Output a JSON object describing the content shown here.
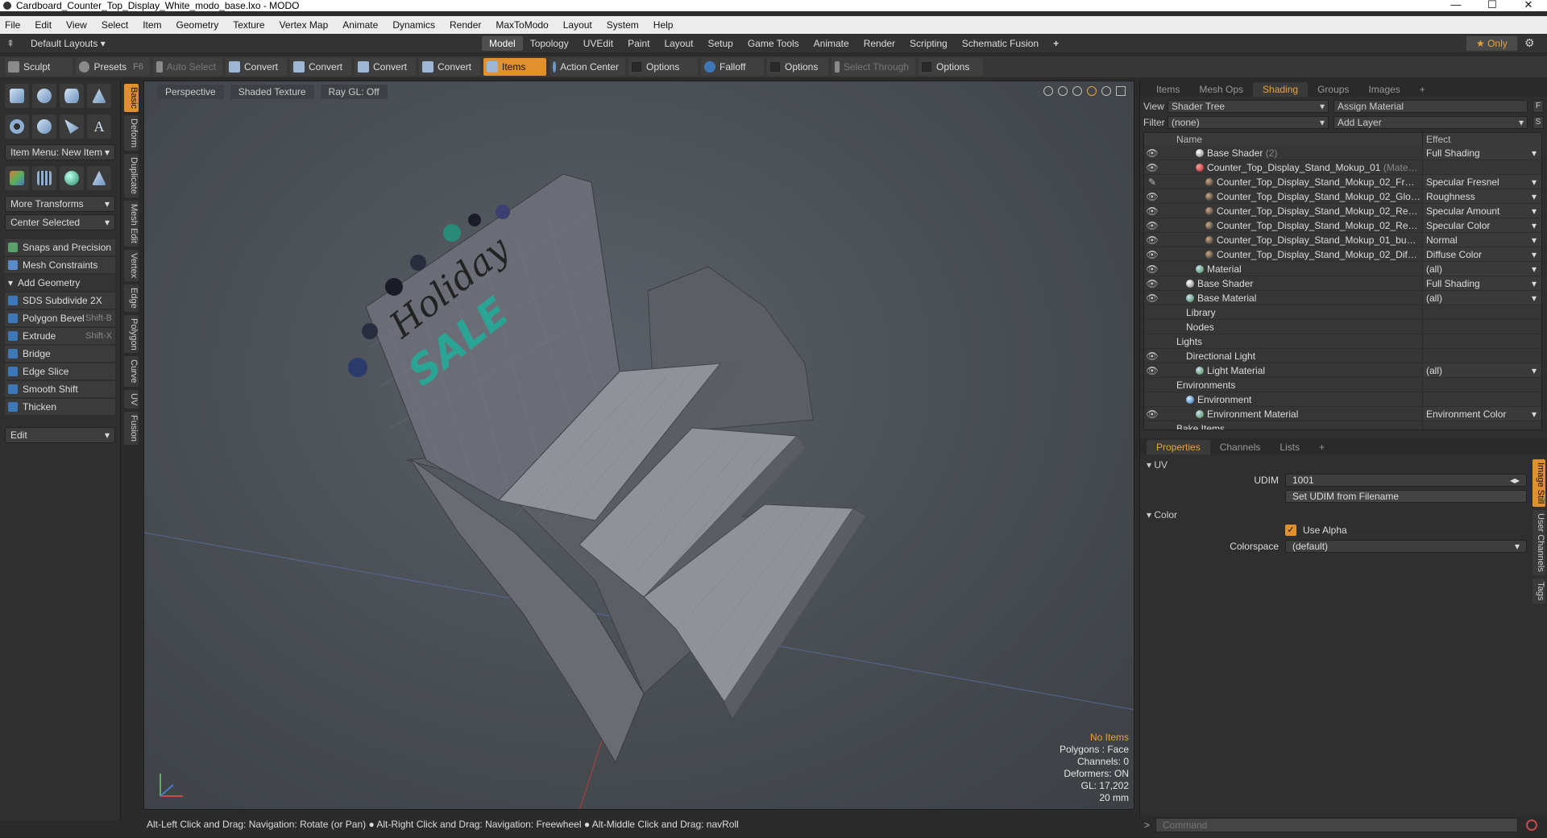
{
  "window": {
    "title": "Cardboard_Counter_Top_Display_White_modo_base.lxo - MODO",
    "minimize": "—",
    "maximize": "☐",
    "close": "✕"
  },
  "menu": [
    "File",
    "Edit",
    "View",
    "Select",
    "Item",
    "Geometry",
    "Texture",
    "Vertex Map",
    "Animate",
    "Dynamics",
    "Render",
    "MaxToModo",
    "Layout",
    "System",
    "Help"
  ],
  "layouts": {
    "default": "Default Layouts ▾",
    "tabs": [
      "Model",
      "Topology",
      "UVEdit",
      "Paint",
      "Layout",
      "Setup",
      "Game Tools",
      "Animate",
      "Render",
      "Scripting",
      "Schematic Fusion"
    ],
    "active_index": 0,
    "plus": "+",
    "only": "★  Only"
  },
  "toolbar": {
    "sculpt": "Sculpt",
    "presets": "Presets",
    "presets_key": "F6",
    "auto_select": "Auto Select",
    "convert1": "Convert",
    "convert2": "Convert",
    "convert3": "Convert",
    "convert4": "Convert",
    "items": "Items",
    "action_center": "Action Center",
    "options1": "Options",
    "falloff": "Falloff",
    "options2": "Options",
    "select_through": "Select Through",
    "options3": "Options"
  },
  "left": {
    "item_menu": "Item Menu: New Item",
    "more_transforms": "More Transforms",
    "center_selected": "Center Selected",
    "snaps": "Snaps and Precision",
    "mesh_constraints": "Mesh Constraints",
    "add_geometry": "Add Geometry",
    "tools": [
      {
        "label": "SDS Subdivide 2X",
        "key": ""
      },
      {
        "label": "Polygon Bevel",
        "key": "Shift-B"
      },
      {
        "label": "Extrude",
        "key": "Shift-X"
      },
      {
        "label": "Bridge",
        "key": ""
      },
      {
        "label": "Edge Slice",
        "key": ""
      },
      {
        "label": "Smooth Shift",
        "key": ""
      },
      {
        "label": "Thicken",
        "key": ""
      }
    ],
    "edit": "Edit",
    "vtabs": [
      "Basic",
      "Deform",
      "Duplicate",
      "Mesh Edit",
      "Vertex",
      "Edge",
      "Polygon",
      "Curve",
      "UV",
      "Fusion"
    ]
  },
  "viewport": {
    "perspective": "Perspective",
    "shading": "Shaded Texture",
    "raygl": "Ray GL: Off",
    "artwork_line1": "Holiday",
    "artwork_line2": "SALE",
    "hud": {
      "no_items": "No Items",
      "polygons": "Polygons : Face",
      "channels": "Channels: 0",
      "deformers": "Deformers: ON",
      "gl": "GL: 17,202",
      "units": "20 mm"
    }
  },
  "status": "Alt-Left Click and Drag: Navigation: Rotate (or Pan) ● Alt-Right Click and Drag: Navigation: Freewheel ● Alt-Middle Click and Drag: navRoll",
  "right": {
    "tabs": [
      "Items",
      "Mesh Ops",
      "Shading",
      "Groups",
      "Images"
    ],
    "active_tab": "Shading",
    "plus": "+",
    "view_label": "View",
    "view_value": "Shader Tree",
    "assign_material": "Assign Material",
    "f_btn": "F",
    "filter_label": "Filter",
    "filter_value": "(none)",
    "add_layer": "Add Layer",
    "s_btn": "S",
    "tree_headers": {
      "name": "Name",
      "effect": "Effect"
    },
    "tree": [
      {
        "eye": "👁",
        "indent": 2,
        "icon": "sh",
        "name": "Base Shader",
        "suffix": " (2)",
        "effect": "Full Shading"
      },
      {
        "eye": "👁",
        "indent": 2,
        "icon": "rd",
        "name": "Counter_Top_Display_Stand_Mokup_01",
        "suffix": " (Mate…",
        "effect": ""
      },
      {
        "eye": "✎",
        "indent": 3,
        "icon": "bk",
        "name": "Counter_Top_Display_Stand_Mokup_02_Fr…",
        "suffix": "",
        "effect": "Specular Fresnel"
      },
      {
        "eye": "👁",
        "indent": 3,
        "icon": "bk",
        "name": "Counter_Top_Display_Stand_Mokup_02_Glo…",
        "suffix": "",
        "effect": "Roughness"
      },
      {
        "eye": "👁",
        "indent": 3,
        "icon": "bk",
        "name": "Counter_Top_Display_Stand_Mokup_02_Re…",
        "suffix": "",
        "effect": "Specular Amount"
      },
      {
        "eye": "👁",
        "indent": 3,
        "icon": "bk",
        "name": "Counter_Top_Display_Stand_Mokup_02_Re…",
        "suffix": "",
        "effect": "Specular Color"
      },
      {
        "eye": "👁",
        "indent": 3,
        "icon": "bk",
        "name": "Counter_Top_Display_Stand_Mokup_01_bu…",
        "suffix": "",
        "effect": "Normal"
      },
      {
        "eye": "👁",
        "indent": 3,
        "icon": "bk",
        "name": "Counter_Top_Display_Stand_Mokup_02_Dif…",
        "suffix": "",
        "effect": "Diffuse Color"
      },
      {
        "eye": "👁",
        "indent": 2,
        "icon": "gr",
        "name": "Material",
        "suffix": "",
        "effect": "(all)"
      },
      {
        "eye": "👁",
        "indent": 1,
        "icon": "sh",
        "name": "Base Shader",
        "suffix": "",
        "effect": "Full Shading"
      },
      {
        "eye": "👁",
        "indent": 1,
        "icon": "gr",
        "name": "Base Material",
        "suffix": "",
        "effect": "(all)"
      },
      {
        "eye": "",
        "indent": 1,
        "icon": "",
        "name": "Library",
        "suffix": "",
        "effect": ""
      },
      {
        "eye": "",
        "indent": 1,
        "icon": "",
        "name": "Nodes",
        "suffix": "",
        "effect": ""
      },
      {
        "eye": "",
        "indent": 0,
        "icon": "",
        "name": "Lights",
        "suffix": "",
        "effect": ""
      },
      {
        "eye": "👁",
        "indent": 1,
        "icon": "",
        "name": "Directional Light",
        "suffix": "",
        "effect": ""
      },
      {
        "eye": "👁",
        "indent": 2,
        "icon": "gr",
        "name": "Light Material",
        "suffix": "",
        "effect": "(all)"
      },
      {
        "eye": "",
        "indent": 0,
        "icon": "",
        "name": "Environments",
        "suffix": "",
        "effect": ""
      },
      {
        "eye": "",
        "indent": 1,
        "icon": "bl",
        "name": "Environment",
        "suffix": "",
        "effect": ""
      },
      {
        "eye": "👁",
        "indent": 2,
        "icon": "gr",
        "name": "Environment Material",
        "suffix": "",
        "effect": "Environment Color"
      },
      {
        "eye": "",
        "indent": 0,
        "icon": "",
        "name": "Bake Items",
        "suffix": "",
        "effect": ""
      }
    ],
    "prop_tabs": [
      "Properties",
      "Channels",
      "Lists"
    ],
    "prop_active": "Properties",
    "uv_section": "UV",
    "udim_label": "UDIM",
    "udim_value": "1001",
    "set_udim": "Set UDIM from Filename",
    "color_section": "Color",
    "use_alpha": "Use Alpha",
    "colorspace_label": "Colorspace",
    "colorspace_value": "(default)",
    "rvtabs": [
      "Image Still",
      "User Channels",
      "Tags"
    ],
    "command_placeholder": "Command"
  }
}
